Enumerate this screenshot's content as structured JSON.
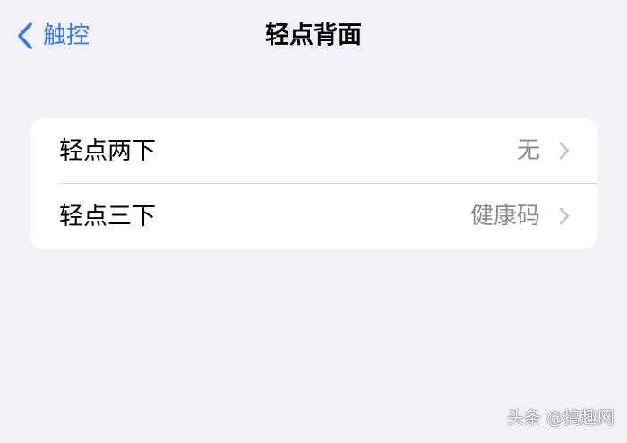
{
  "nav": {
    "back_label": "触控",
    "title": "轻点背面",
    "back_icon": "chevron-left-icon"
  },
  "settings": {
    "rows": [
      {
        "label": "轻点两下",
        "value": "无",
        "icon": "chevron-right-icon"
      },
      {
        "label": "轻点三下",
        "value": "健康码",
        "icon": "chevron-right-icon"
      }
    ]
  },
  "watermark": {
    "text": "头条 @搞趣网"
  },
  "colors": {
    "accent": "#3478f6",
    "background": "#f2f1f7",
    "card": "#ffffff",
    "secondary_text": "#8a8a8e",
    "chevron": "#c4c4c7"
  }
}
